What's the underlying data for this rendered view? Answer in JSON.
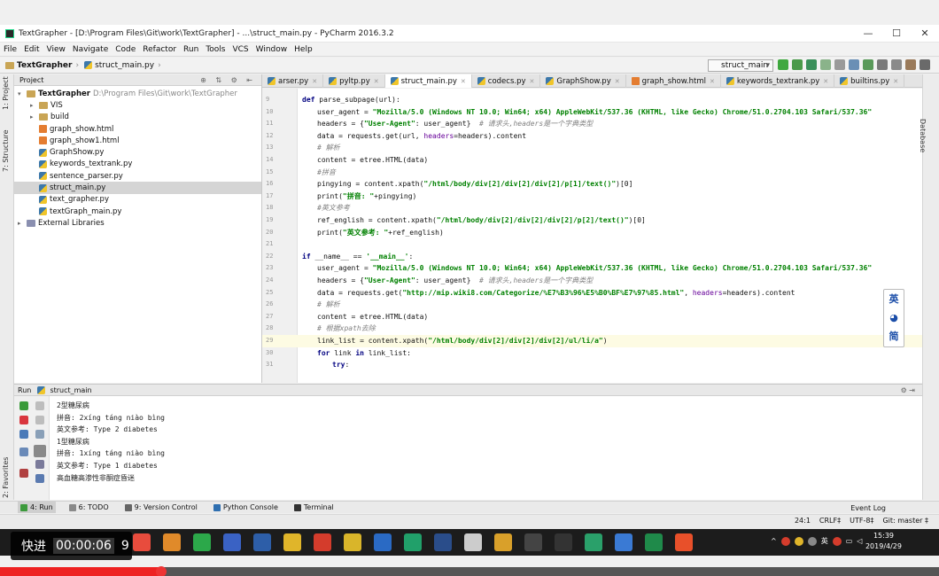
{
  "window": {
    "title": "TextGrapher - [D:\\Program Files\\Git\\work\\TextGrapher] - ...\\struct_main.py - PyCharm 2016.3.2",
    "controls": [
      "—",
      "☐",
      "✕"
    ]
  },
  "menu": [
    "File",
    "Edit",
    "View",
    "Navigate",
    "Code",
    "Refactor",
    "Run",
    "Tools",
    "VCS",
    "Window",
    "Help"
  ],
  "breadcrumb": [
    "TextGrapher",
    "struct_main.py"
  ],
  "run_config": "struct_main",
  "project_panel": {
    "header": "Project",
    "tree": [
      {
        "label": "TextGrapher",
        "detail": "D:\\Program Files\\Git\\work\\TextGrapher",
        "type": "folder",
        "arrow": "▾",
        "indent": 0,
        "bold": true
      },
      {
        "label": "VIS",
        "type": "folder",
        "arrow": "▸",
        "indent": 1
      },
      {
        "label": "build",
        "type": "folder",
        "arrow": "▸",
        "indent": 1
      },
      {
        "label": "graph_show.html",
        "type": "html",
        "indent": 1
      },
      {
        "label": "graph_show1.html",
        "type": "html",
        "indent": 1
      },
      {
        "label": "GraphShow.py",
        "type": "py",
        "indent": 1
      },
      {
        "label": "keywords_textrank.py",
        "type": "py",
        "indent": 1
      },
      {
        "label": "sentence_parser.py",
        "type": "py",
        "indent": 1
      },
      {
        "label": "struct_main.py",
        "type": "py",
        "indent": 1,
        "selected": true
      },
      {
        "label": "text_grapher.py",
        "type": "py",
        "indent": 1
      },
      {
        "label": "textGraph_main.py",
        "type": "py",
        "indent": 1
      },
      {
        "label": "External Libraries",
        "type": "lib",
        "arrow": "▸",
        "indent": 0
      }
    ]
  },
  "left_stripe": [
    "1: Project",
    "7: Structure",
    "2: Favorites"
  ],
  "right_stripe": [
    "Database"
  ],
  "tabs": [
    {
      "label": "arser.py",
      "type": "py"
    },
    {
      "label": "pyltp.py",
      "type": "py"
    },
    {
      "label": "struct_main.py",
      "type": "py",
      "active": true
    },
    {
      "label": "codecs.py",
      "type": "py"
    },
    {
      "label": "GraphShow.py",
      "type": "py"
    },
    {
      "label": "graph_show.html",
      "type": "html"
    },
    {
      "label": "keywords_textrank.py",
      "type": "py"
    },
    {
      "label": "builtins.py",
      "type": "py"
    }
  ],
  "code": [
    {
      "n": "9",
      "indent": 0,
      "text": "def parse_subpage(url):"
    },
    {
      "n": "10",
      "indent": 1,
      "text": "user_agent = \"Mozilla/5.0 (Windows NT 10.0; Win64; x64) AppleWebKit/537.36 (KHTML, like Gecko) Chrome/51.0.2704.103 Safari/537.36\""
    },
    {
      "n": "11",
      "indent": 1,
      "text": "headers = {\"User-Agent\": user_agent}  # 请求头,headers是一个字典类型"
    },
    {
      "n": "12",
      "indent": 1,
      "text": "data = requests.get(url, headers=headers).content"
    },
    {
      "n": "13",
      "indent": 1,
      "text": "# 解析"
    },
    {
      "n": "14",
      "indent": 1,
      "text": "content = etree.HTML(data)"
    },
    {
      "n": "15",
      "indent": 1,
      "text": "#拼音"
    },
    {
      "n": "16",
      "indent": 1,
      "text": "pingying = content.xpath(\"/html/body/div[2]/div[2]/div[2]/p[1]/text()\")[0]"
    },
    {
      "n": "17",
      "indent": 1,
      "text": "print(\"拼音: \"+pingying)"
    },
    {
      "n": "18",
      "indent": 1,
      "text": "#英文参考"
    },
    {
      "n": "19",
      "indent": 1,
      "text": "ref_english = content.xpath(\"/html/body/div[2]/div[2]/div[2]/p[2]/text()\")[0]"
    },
    {
      "n": "20",
      "indent": 1,
      "text": "print(\"英文参考: \"+ref_english)"
    },
    {
      "n": "21",
      "indent": 0,
      "text": ""
    },
    {
      "n": "22",
      "indent": 0,
      "text": "if __name__ == '__main__':"
    },
    {
      "n": "23",
      "indent": 1,
      "text": "user_agent = \"Mozilla/5.0 (Windows NT 10.0; Win64; x64) AppleWebKit/537.36 (KHTML, like Gecko) Chrome/51.0.2704.103 Safari/537.36\""
    },
    {
      "n": "24",
      "indent": 1,
      "text": "headers = {\"User-Agent\": user_agent}  # 请求头,headers是一个字典类型"
    },
    {
      "n": "25",
      "indent": 1,
      "text": "data = requests.get(\"http://mip.wiki8.com/Categorize/%E7%B3%96%E5%B0%BF%E7%97%85.html\", headers=headers).content"
    },
    {
      "n": "26",
      "indent": 1,
      "text": "# 解析"
    },
    {
      "n": "27",
      "indent": 1,
      "text": "content = etree.HTML(data)"
    },
    {
      "n": "28",
      "indent": 1,
      "text": "# 根据xpath去除"
    },
    {
      "n": "29",
      "indent": 1,
      "text": "link_list = content.xpath(\"/html/body/div[2]/div[2]/div[2]/ul/li/a\")",
      "highlight": true
    },
    {
      "n": "30",
      "indent": 1,
      "text": "for link in link_list:"
    },
    {
      "n": "31",
      "indent": 2,
      "text": "try:"
    }
  ],
  "ime": [
    "英",
    "◕",
    "简"
  ],
  "run_panel": {
    "title": "Run",
    "config": "struct_main",
    "output": [
      "2型糖尿病",
      "拼音: 2xíng táng niào bìng",
      "英文参考: Type 2 diabetes",
      "1型糖尿病",
      "拼音: 1xíng táng niào bìng",
      "英文参考: Type 1 diabetes",
      "高血糖高渗性非酮症昏迷"
    ]
  },
  "bottom_tabs": [
    {
      "label": "4: Run",
      "active": true,
      "color": "#3c9a3c"
    },
    {
      "label": "6: TODO",
      "color": "#8a8a8a"
    },
    {
      "label": "9: Version Control",
      "color": "#666"
    },
    {
      "label": "Python Console",
      "color": "#2f6fb0"
    },
    {
      "label": "Terminal",
      "color": "#333"
    }
  ],
  "event_log": "Event Log",
  "status_bar": [
    "24:1",
    "CRLF‡",
    "UTF-8‡",
    "Git: master ‡"
  ],
  "taskbar": {
    "time": "15:39",
    "date": "2019/4/29",
    "ime": "英",
    "apps": [
      "#e84c3d",
      "#e08a2a",
      "#2ca84a",
      "#3a62c4",
      "#2d5ea8",
      "#e0b52a",
      "#d43c2c",
      "#d9b52a",
      "#2a6ac4",
      "#21a06a",
      "#2a4d8a",
      "#cccccc",
      "#d9a02a",
      "#444444",
      "#333333",
      "#2aa06a",
      "#3a7ad4",
      "#1f8a4a",
      "#e8502a"
    ]
  },
  "video_overlay": {
    "label": "快进",
    "time": "00:00:06",
    "trailing": "9"
  },
  "video_progress": 0.172
}
